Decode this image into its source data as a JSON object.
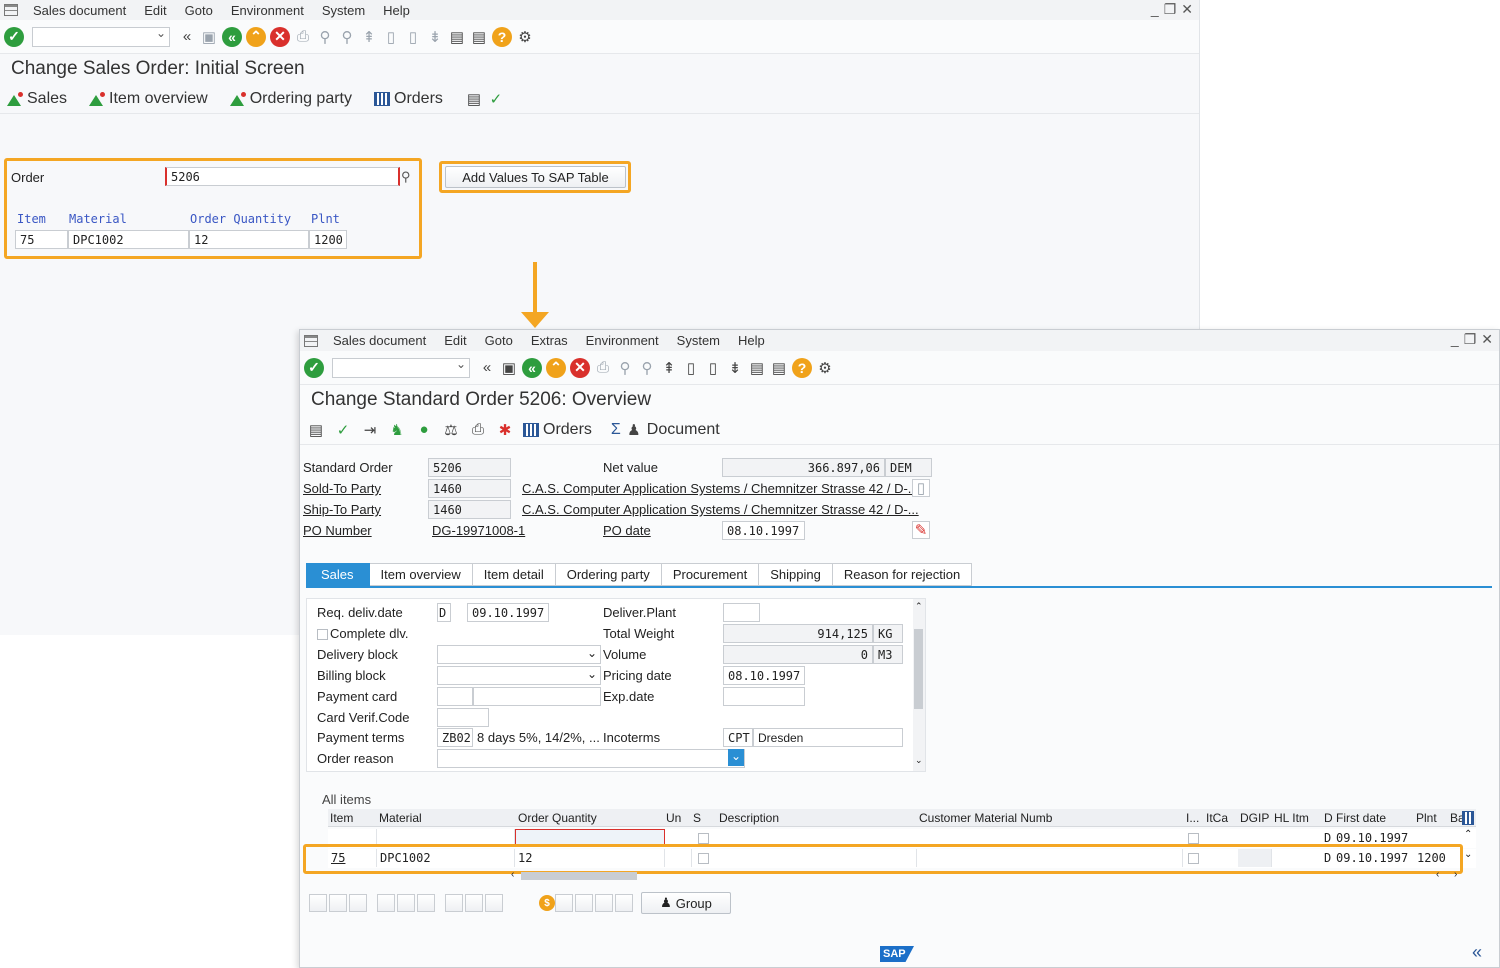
{
  "bg_window": {
    "menu": [
      "Sales document",
      "Edit",
      "Goto",
      "Environment",
      "System",
      "Help"
    ],
    "title": "Change Sales Order: Initial Screen",
    "app_toolbar": [
      "Sales",
      "Item overview",
      "Ordering party",
      "Orders"
    ],
    "order_label": "Order",
    "order_value": "5206",
    "add_button": "Add Values To SAP Table",
    "columns": [
      "Item",
      "Material",
      "Order Quantity",
      "Plnt"
    ],
    "row": [
      "75",
      "DPC1002",
      "12",
      "1200"
    ]
  },
  "fg_window": {
    "menu": [
      "Sales document",
      "Edit",
      "Goto",
      "Extras",
      "Environment",
      "System",
      "Help"
    ],
    "title": "Change Standard Order 5206: Overview",
    "toolbar_orders": "Orders",
    "toolbar_document": "Document",
    "header": {
      "standard_order_label": "Standard Order",
      "standard_order_value": "5206",
      "net_value_label": "Net value",
      "net_value": "366.897,06",
      "currency": "DEM",
      "sold_to_label": "Sold-To Party",
      "sold_to_value": "1460",
      "sold_to_name": "C.A.S. Computer Application Systems / Chemnitzer Strasse 42 / D-...",
      "ship_to_label": "Ship-To Party",
      "ship_to_value": "1460",
      "ship_to_name": "C.A.S. Computer Application Systems / Chemnitzer Strasse 42 / D-...",
      "po_number_label": "PO Number",
      "po_number_value": "DG-19971008-1",
      "po_date_label": "PO date",
      "po_date_value": "08.10.1997"
    },
    "tabs": [
      "Sales",
      "Item overview",
      "Item detail",
      "Ordering party",
      "Procurement",
      "Shipping",
      "Reason for rejection"
    ],
    "sales_panel": {
      "req_deliv_label": "Req. deliv.date",
      "req_deliv_unit": "D",
      "req_deliv_value": "09.10.1997",
      "deliver_plant_label": "Deliver.Plant",
      "complete_dlv_label": "Complete dlv.",
      "total_weight_label": "Total Weight",
      "total_weight_value": "914,125",
      "total_weight_unit": "KG",
      "delivery_block_label": "Delivery block",
      "volume_label": "Volume",
      "volume_value": "0",
      "volume_unit": "M3",
      "billing_block_label": "Billing block",
      "pricing_date_label": "Pricing date",
      "pricing_date_value": "08.10.1997",
      "payment_card_label": "Payment card",
      "exp_date_label": "Exp.date",
      "card_verif_label": "Card Verif.Code",
      "payment_terms_label": "Payment terms",
      "payment_terms_code": "ZB02",
      "payment_terms_text": "8 days 5%, 14/2%, ...",
      "incoterms_label": "Incoterms",
      "incoterms_code": "CPT",
      "incoterms_text": "Dresden",
      "order_reason_label": "Order reason"
    },
    "items": {
      "section_label": "All items",
      "columns": [
        "Item",
        "Material",
        "Order Quantity",
        "Un",
        "S",
        "Description",
        "Customer Material Numb",
        "I...",
        "ItCa",
        "DGIP",
        "HL Itm",
        "D",
        "First date",
        "Plnt",
        "Ba"
      ],
      "row1": {
        "d": "D",
        "first_date": "09.10.1997"
      },
      "row2": {
        "item": "75",
        "material": "DPC1002",
        "qty": "12",
        "d": "D",
        "first_date": "09.10.1997",
        "plnt": "1200"
      }
    },
    "group_button": "Group",
    "logo": "SAP"
  }
}
